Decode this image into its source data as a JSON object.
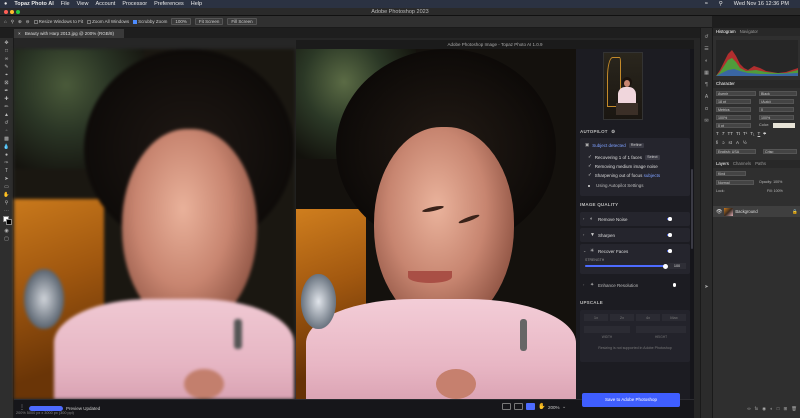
{
  "menubar": {
    "app": "Topaz Photo AI",
    "items": [
      "File",
      "View",
      "Account",
      "Processor",
      "Preferences",
      "Help"
    ],
    "clock": "Wed Nov 16  12:36 PM"
  },
  "ps": {
    "window_title": "Adobe Photoshop 2023",
    "options": {
      "resize_windows": "Resize Windows to Fit",
      "zoom_all": "Zoom All Windows",
      "scrubby": "Scrubby Zoom",
      "zoom_value": "100%",
      "fit_screen": "Fit Screen",
      "fill_screen": "Fill Screen"
    },
    "doc_tab": "Beauty with Harp 2013.jpg @ 200% (RGB/8)",
    "status": "200%    5000 px x 3000 px (300 ppi)"
  },
  "topaz": {
    "window_title": "Adobe Photoshop Image - Topaz Photo AI 1.0.9",
    "autopilot": {
      "heading": "AUTOPILOT",
      "subject_label": "Subject detected",
      "subject_btn": "Refine",
      "recovering": "Recovering 1 of 1 faces",
      "recovering_btn": "Select",
      "removing": "Removing medium image noise",
      "sharpening_prefix": "Sharpening out of focus",
      "sharpening_link": "subjects",
      "settings": "Using Autopilot Settings"
    },
    "quality": {
      "heading": "IMAGE QUALITY",
      "remove_noise": "Remove Noise",
      "sharpen": "Sharpen",
      "recover_faces": "Recover Faces",
      "strength_label": "STRENGTH",
      "strength_value": "100",
      "strength_fraction": 1.0,
      "enhance": "Enhance Resolution"
    },
    "upscale": {
      "heading": "UPSCALE",
      "scales": [
        "1x",
        "2x",
        "4x",
        "Max"
      ],
      "width_label": "WIDTH",
      "height_label": "HEIGHT",
      "note": "Resizing is not supported in Adobe Photoshop"
    },
    "bottom": {
      "status": "Preview Updated",
      "progress": 1.0,
      "zoom": "200%"
    },
    "save_button": "Save to Adobe Photoshop"
  },
  "dock": {
    "top_tabs": [
      "Histogram",
      "Navigator"
    ],
    "character_tab": "Character",
    "font": "Avenir",
    "font_style": "Black",
    "size": "18 pt",
    "leading": "(Auto)",
    "kerning": "Metrics",
    "tracking": "0",
    "vscale": "100%",
    "hscale": "100%",
    "baseline": "0 pt",
    "color_label": "Color:",
    "language": "English: USA",
    "aa": "Crisp",
    "layers_tabs": [
      "Layers",
      "Channels",
      "Paths"
    ],
    "kind": "Kind",
    "blend": "Normal",
    "opacity": "Opacity: 100%",
    "lock": "Lock:",
    "fill": "Fill: 100%",
    "layer_name": "Background"
  }
}
